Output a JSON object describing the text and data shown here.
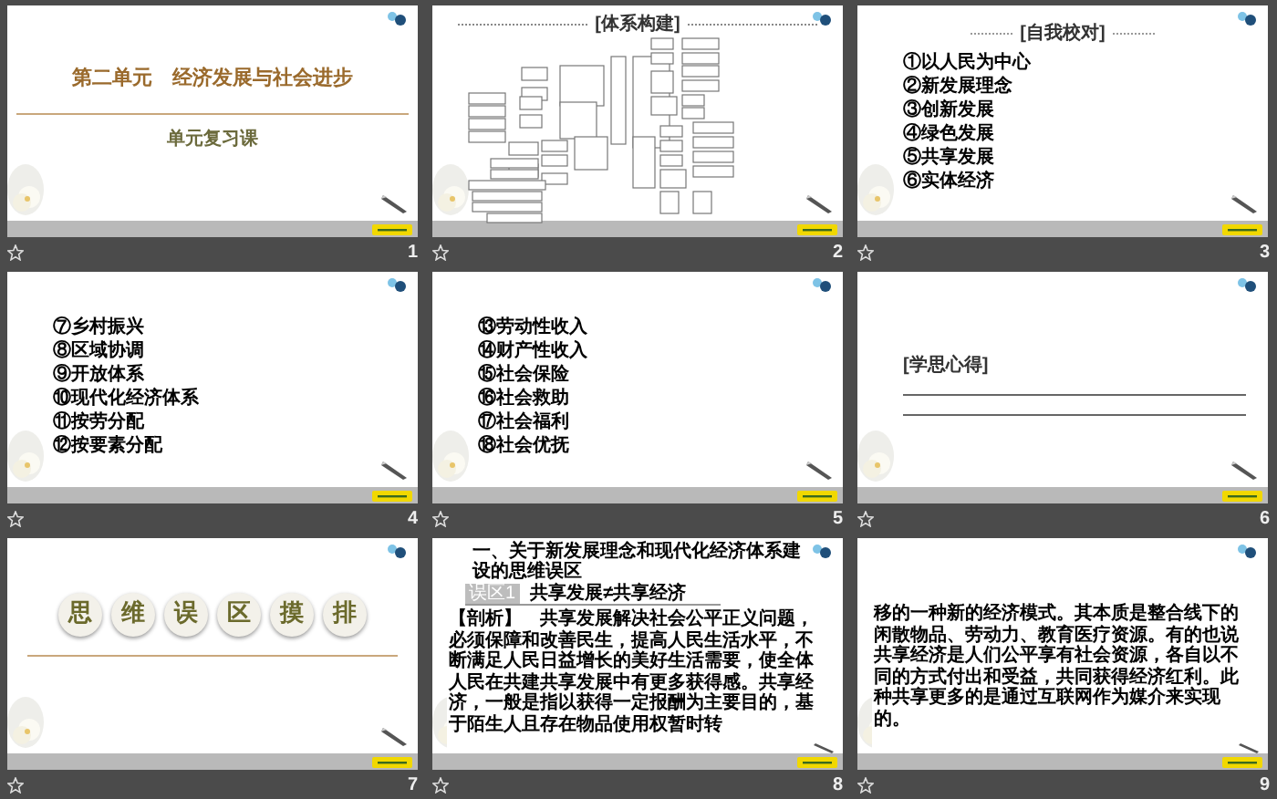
{
  "slides": [
    {
      "number": "1",
      "kind": "title",
      "title": "第二单元　经济发展与社会进步",
      "subtitle": "单元复习课"
    },
    {
      "number": "2",
      "kind": "diagram",
      "heading": "[体系构建]"
    },
    {
      "number": "3",
      "kind": "list",
      "heading": "[自我校对]",
      "items": [
        "①以人民为中心",
        "②新发展理念",
        "③创新发展",
        "④绿色发展",
        "⑤共享发展",
        "⑥实体经济"
      ]
    },
    {
      "number": "4",
      "kind": "list",
      "items": [
        "⑦乡村振兴",
        "⑧区域协调",
        "⑨开放体系",
        "⑩现代化经济体系",
        "⑪按劳分配",
        "⑫按要素分配"
      ]
    },
    {
      "number": "5",
      "kind": "list",
      "items": [
        "⑬劳动性收入",
        "⑭财产性收入",
        "⑮社会保险",
        "⑯社会救助",
        "⑰社会福利",
        "⑱社会优抚"
      ]
    },
    {
      "number": "6",
      "kind": "notes",
      "heading": "[学思心得]"
    },
    {
      "number": "7",
      "kind": "section",
      "chars": [
        "思",
        "维",
        "误",
        "区",
        "摸",
        "排"
      ]
    },
    {
      "number": "8",
      "kind": "text",
      "heading": "一、关于新发展理念和现代化经济体系建设的思维误区",
      "tag": "误区1",
      "tag_title": "共享发展≠共享经济",
      "paragraph": "【剖析】　共享发展解决社会公平正义问题，必须保障和改善民生，提高人民生活水平，不断满足人民日益增长的美好生活需要，使全体人民在共建共享发展中有更多获得感。共享经济，一般是指以获得一定报酬为主要目的，基于陌生人且存在物品使用权暂时转"
    },
    {
      "number": "9",
      "kind": "text",
      "paragraph": "移的一种新的经济模式。其本质是整合线下的闲散物品、劳动力、教育医疗资源。有的也说共享经济是人们公平享有社会资源，各自以不同的方式付出和受益，共同获得经济红利。此种共享更多的是通过互联网作为媒介来实现的。"
    }
  ]
}
